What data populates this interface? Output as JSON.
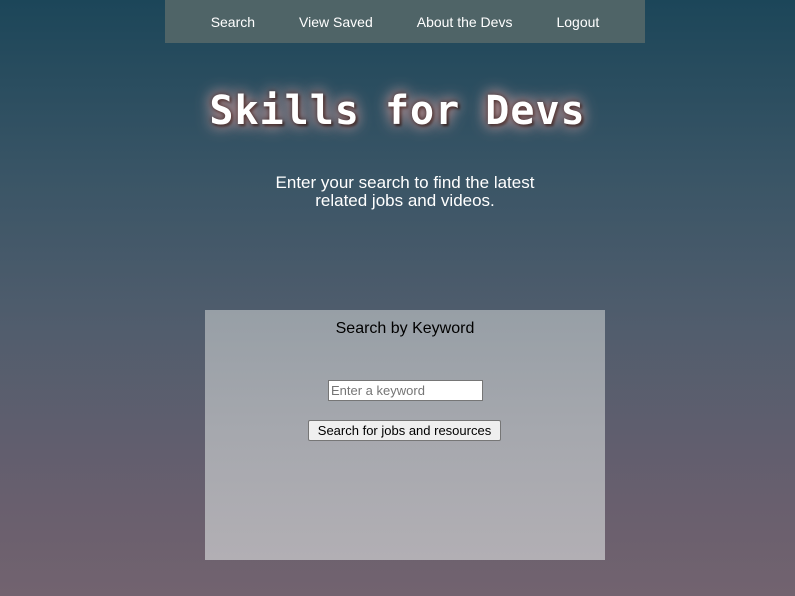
{
  "nav": {
    "items": [
      {
        "label": "Search"
      },
      {
        "label": "View Saved"
      },
      {
        "label": "About the Devs"
      },
      {
        "label": "Logout"
      }
    ]
  },
  "header": {
    "title": "Skills for Devs",
    "subtitle": "Enter your search to find the latest related jobs and videos."
  },
  "search": {
    "heading": "Search by Keyword",
    "placeholder": "Enter a keyword",
    "value": "",
    "button_label": "Search for jobs and resources"
  }
}
